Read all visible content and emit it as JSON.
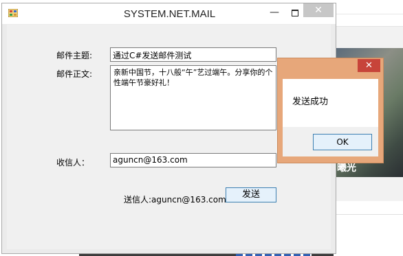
{
  "window": {
    "title": "SYSTEM.NET.MAIL",
    "minimize_glyph": "—",
    "close_glyph": "✕",
    "icon": "winforms-app-icon"
  },
  "form": {
    "subject_label": "邮件主题:",
    "subject_value": "通过C#发送邮件测试",
    "body_label": "邮件正文:",
    "body_value": "亲新中国节，十八般“午”艺过端午。分享你的个性端午节豪好礼！",
    "recipient_label": "收信人：",
    "recipient_value": "aguncn@163.com",
    "sender_text": "送信人:aguncn@163.com",
    "send_button": "发送"
  },
  "message_box": {
    "text": "发送成功",
    "ok_button": "OK",
    "close_glyph": "✕"
  },
  "background_page": {
    "photo_caption": "曦光"
  }
}
